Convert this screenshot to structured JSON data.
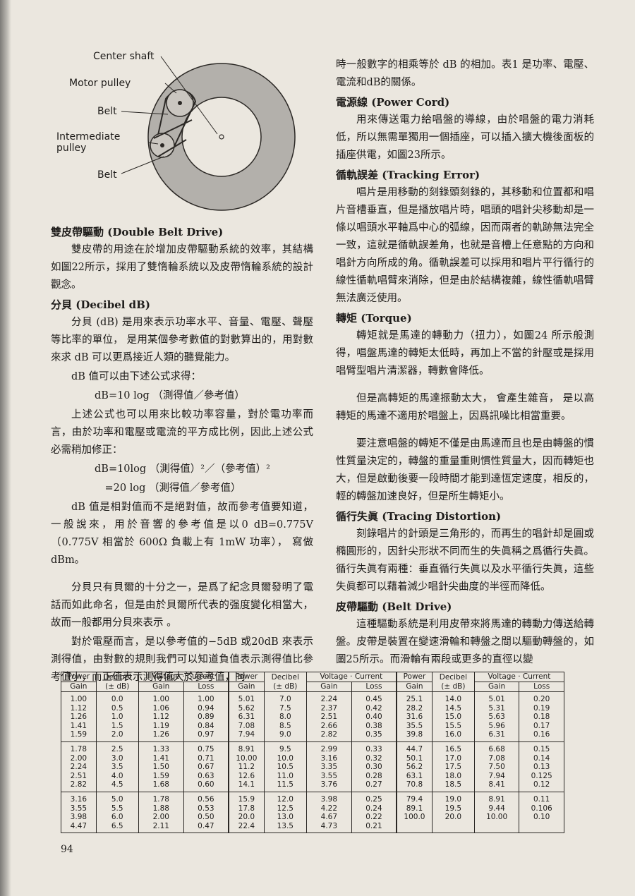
{
  "diagram": {
    "labels": {
      "center_shaft": "Center shaft",
      "motor_pulley": "Motor pulley",
      "belt_top": "Belt",
      "intermediate_1": "Intermediate",
      "intermediate_2": "pulley",
      "belt_bottom": "Belt"
    }
  },
  "left_col": [
    {
      "kind": "h",
      "text": "雙皮帶驅動 (Double Belt Drive)"
    },
    {
      "kind": "p",
      "text": "雙皮帶的用途在於增加皮帶驅動系統的效率，其結構如圖22所示，採用了雙惰輪系統以及皮帶惰輪系統的設計觀念。"
    },
    {
      "kind": "h",
      "text": "分貝 (Decibel dB)"
    },
    {
      "kind": "p",
      "text": "分貝 (dB) 是用來表示功率水平、音量、電壓、聲壓等比率的單位， 是用某個參考數值的對數算出的，用對數來求 dB 可以更爲接近人類的聽覺能力。"
    },
    {
      "kind": "p",
      "text": "dB 值可以由下述公式求得："
    },
    {
      "kind": "formula",
      "text": "dB=10 log （測得值／參考值）"
    },
    {
      "kind": "p",
      "text": "上述公式也可以用來比較功率容量，對於電功率而言，由於功率和電壓或電流的平方成比例，因此上述公式必需稍加修正："
    },
    {
      "kind": "formula",
      "text": "dB=10log （測得值）²／（參考值）²"
    },
    {
      "kind": "formula2",
      "text": "　=20 log （測得值／參考值）"
    },
    {
      "kind": "p",
      "text": "dB 值是相對值而不是絕對值，故而參考值要知道，一般說來，用於音響的參考值是以0 dB=0.775V （0.775V 相當於 600Ω 負載上有 1mW 功率）， 寫做 dBm。"
    },
    {
      "kind": "pgap",
      "text": "分貝只有貝爾的十分之一，是爲了紀念貝爾發明了電話而如此命名，但是由於貝爾所代表的强度變化相當大，故而一般都用分貝來表示 。"
    },
    {
      "kind": "p",
      "text": "對於電壓而言，是以參考值的−5dB 或20dB 來表示測得值，由對數的規則我們可以知道負值表示測得值比參考值小，而正值表示測得值大於參考值，同"
    }
  ],
  "right_col": [
    {
      "kind": "pn",
      "text": "時一般數字的相乘等於 dB 的相加。表1 是功率、電壓、電流和dB的關係。"
    },
    {
      "kind": "h",
      "text": "電源線 (Power Cord)"
    },
    {
      "kind": "p",
      "text": "用來傳送電力給唱盤的導線，由於唱盤的電力消耗低，所以無需單獨用一個插座，可以插入擴大機後面板的插座供電，如圖23所示。"
    },
    {
      "kind": "h",
      "text": "循軌誤差 (Tracking Error)"
    },
    {
      "kind": "p",
      "text": "唱片是用移動的刻錄頭刻錄的，其移動和位置都和唱片音槽垂直，但是播放唱片時，唱頭的唱針尖移動却是一條以唱頭水平軸爲中心的弧線，因而兩者的軌跡無法完全一致，這就是循軌誤差角，也就是音槽上任意點的方向和唱針方向所成的角。循軌誤差可以採用和唱片平行循行的線性循軌唱臂來消除，但是由於結構複雜，線性循軌唱臂無法廣泛使用。"
    },
    {
      "kind": "h",
      "text": "轉矩 (Torque)"
    },
    {
      "kind": "p",
      "text": "轉矩就是馬達的轉動力（扭力），如圖24 所示般測得，唱盤馬達的轉矩太低時，再加上不當的針壓或是採用唱臂型唱片清潔器，轉數會降低。"
    },
    {
      "kind": "pgap",
      "text": "但是高轉矩的馬達振動太大， 會產生雜音， 是以高轉矩的馬達不適用於唱盤上，因爲訊噪比相當重要。"
    },
    {
      "kind": "pgap",
      "text": "要注意唱盤的轉矩不僅是由馬達而且也是由轉盤的慣性質量決定的，轉盤的重量重則慣性質量大，因而轉矩也大，但是啟動後要一段時間才能到達恆定速度，相反的，輕的轉盤加速良好，但是所生轉矩小。"
    },
    {
      "kind": "h",
      "text": "循行失眞 (Tracing Distortion)"
    },
    {
      "kind": "p",
      "text": "刻錄唱片的針頭是三角形的，而再生的唱針却是圓或橢圓形的，因針尖形狀不同而生的失眞稱之爲循行失眞。循行失眞有兩種：垂直循行失眞以及水平循行失眞，這些失眞都可以藉着減少唱針尖曲度的半徑而降低。"
    },
    {
      "kind": "h",
      "text": "皮帶驅動 (Belt Drive)"
    },
    {
      "kind": "p",
      "text": "這種驅動系統是利用皮帶來將馬達的轉動力傳送給轉盤。皮帶是裝置在變速滑輪和轉盤之間以驅動轉盤的，如圖25所示。而滑輪有兩段或更多的直徑以變"
    }
  ],
  "table": {
    "headers": {
      "power": "Power",
      "decibel": "Decibel",
      "decibel_unit": "(± dB)",
      "voltage_current": "Voltage · Current",
      "gain": "Gain",
      "loss": "Loss"
    },
    "groups": [
      {
        "power": [
          "1.00\n1.12\n1.26\n1.41\n1.59",
          "1.78\n2.00\n2.24\n2.51\n2.82",
          "3.16\n3.55\n3.98\n4.47"
        ],
        "decibel": [
          "0.0\n0.5\n1.0\n1.5\n2.0",
          "2.5\n3.0\n3.5\n4.0\n4.5",
          "5.0\n5.5\n6.0\n6.5"
        ],
        "gain": [
          "1.00\n1.06\n1.12\n1.19\n1.26",
          "1.33\n1.41\n1.50\n1.59\n1.68",
          "1.78\n1.88\n2.00\n2.11"
        ],
        "loss": [
          "1.00\n0.94\n0.89\n0.84\n0.97",
          "0.75\n0.71\n0.67\n0.63\n0.60",
          "0.56\n0.53\n0.50\n0.47"
        ]
      },
      {
        "power": [
          "5.01\n5.62\n6.31\n7.08\n7.94",
          "8.91\n10.00\n11.2\n12.6\n14.1",
          "15.9\n17.8\n20.0\n22.4"
        ],
        "decibel": [
          "7.0\n7.5\n8.0\n8.5\n9.0",
          "9.5\n10.0\n10.5\n11.0\n11.5",
          "12.0\n12.5\n13.0\n13.5"
        ],
        "gain": [
          "2.24\n2.37\n2.51\n2.66\n2.82",
          "2.99\n3.16\n3.35\n3.55\n3.76",
          "3.98\n4.22\n4.67\n4.73"
        ],
        "loss": [
          "0.45\n0.42\n0.40\n0.38\n0.35",
          "0.33\n0.32\n0.30\n0.28\n0.27",
          "0.25\n0.24\n0.22\n0.21"
        ]
      },
      {
        "power": [
          "25.1\n28.2\n31.6\n35.5\n39.8",
          "44.7\n50.1\n56.2\n63.1\n70.8",
          "79.4\n89.1\n100.0"
        ],
        "decibel": [
          "14.0\n14.5\n15.0\n15.5\n16.0",
          "16.5\n17.0\n17.5\n18.0\n18.5",
          "19.0\n19.5\n20.0"
        ],
        "gain": [
          "5.01\n5.31\n5.63\n5.96\n6.31",
          "6.68\n7.08\n7.50\n7.94\n8.41",
          "8.91\n9.44\n10.00"
        ],
        "loss": [
          "0.20\n0.19\n0.18\n0.17\n0.16",
          "0.15\n0.14\n0.13\n0.125\n0.12",
          "0.11\n0.106\n0.10"
        ]
      }
    ]
  },
  "page_number": "94"
}
